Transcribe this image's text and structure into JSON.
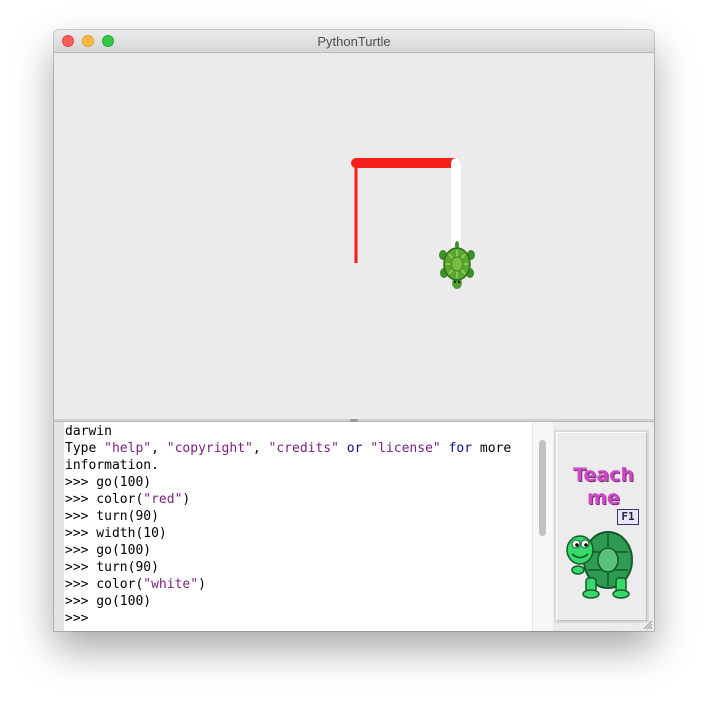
{
  "window": {
    "title": "PythonTurtle"
  },
  "canvas": {
    "background": "#ebebeb",
    "pen_color": "#ff1a1a",
    "trail_color": "#ffffff",
    "turtle": "turtle-sprite"
  },
  "shell": {
    "lines": [
      [
        {
          "t": "darwin",
          "c": "plain"
        }
      ],
      [
        {
          "t": "Type ",
          "c": "plain"
        },
        {
          "t": "\"help\"",
          "c": "str"
        },
        {
          "t": ", ",
          "c": "plain"
        },
        {
          "t": "\"copyright\"",
          "c": "str"
        },
        {
          "t": ", ",
          "c": "plain"
        },
        {
          "t": "\"credits\"",
          "c": "str"
        },
        {
          "t": " ",
          "c": "plain"
        },
        {
          "t": "or",
          "c": "kw"
        },
        {
          "t": " ",
          "c": "plain"
        },
        {
          "t": "\"license\"",
          "c": "str"
        },
        {
          "t": " ",
          "c": "plain"
        },
        {
          "t": "for",
          "c": "kw"
        },
        {
          "t": " more",
          "c": "plain"
        }
      ],
      [
        {
          "t": "information.",
          "c": "plain"
        }
      ],
      [
        {
          "t": ">>> go(100)",
          "c": "plain"
        }
      ],
      [
        {
          "t": ">>> color(",
          "c": "plain"
        },
        {
          "t": "\"red\"",
          "c": "str"
        },
        {
          "t": ")",
          "c": "plain"
        }
      ],
      [
        {
          "t": ">>> turn(90)",
          "c": "plain"
        }
      ],
      [
        {
          "t": ">>> width(10)",
          "c": "plain"
        }
      ],
      [
        {
          "t": ">>> go(100)",
          "c": "plain"
        }
      ],
      [
        {
          "t": ">>> turn(90)",
          "c": "plain"
        }
      ],
      [
        {
          "t": ">>> color(",
          "c": "plain"
        },
        {
          "t": "\"white\"",
          "c": "str"
        },
        {
          "t": ")",
          "c": "plain"
        }
      ],
      [
        {
          "t": ">>> go(100)",
          "c": "plain"
        }
      ],
      [
        {
          "t": ">>>",
          "c": "plain"
        }
      ]
    ]
  },
  "teach_me": {
    "line1": "Teach",
    "line2": "me",
    "shortcut": "F1",
    "icon": "turtle-mascot-icon"
  },
  "colors": {
    "string_literal": "#7a1f7f",
    "keyword": "#0a0a8c",
    "teach_text": "#c94bc1"
  }
}
